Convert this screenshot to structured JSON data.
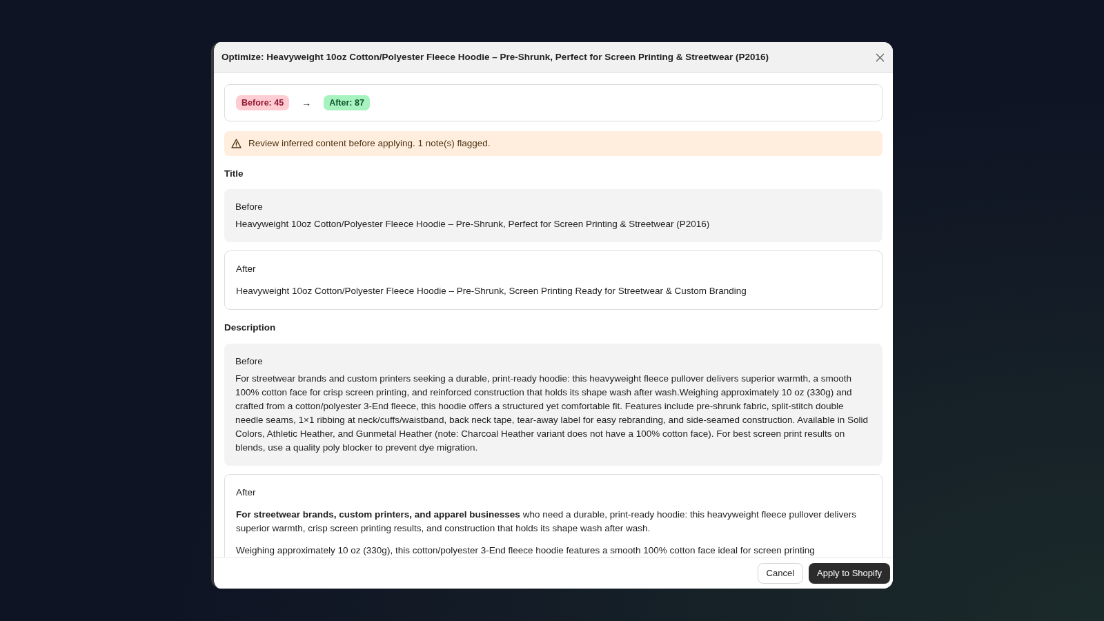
{
  "dialog": {
    "title": "Optimize: Heavyweight 10oz Cotton/Polyester Fleece Hoodie – Pre-Shrunk, Perfect for Screen Printing & Streetwear (P2016)"
  },
  "scores": {
    "before": "Before: 45",
    "arrow": "→",
    "after": "After: 87"
  },
  "warning": "Review inferred content before applying. 1 note(s) flagged.",
  "sections": [
    {
      "heading": "Title",
      "before_label": "Before",
      "before": [
        "Heavyweight 10oz Cotton/Polyester Fleece Hoodie – Pre-Shrunk, Perfect for Screen Printing & Streetwear (P2016)"
      ],
      "after_label": "After",
      "after": [
        "Heavyweight 10oz Cotton/Polyester Fleece Hoodie – Pre-Shrunk, Screen Printing Ready for Streetwear & Custom Branding"
      ]
    },
    {
      "heading": "Description",
      "before_label": "Before",
      "before": [
        "For streetwear brands and custom printers seeking a durable, print-ready hoodie: this heavyweight fleece pullover delivers superior warmth, a smooth 100% cotton face for crisp screen printing, and reinforced construction that holds its shape wash after wash.Weighing approximately 10 oz (330g) and crafted from a cotton/polyester 3-End fleece, this hoodie offers a structured yet comfortable fit. Features include pre-shrunk fabric, split-stitch double needle seams, 1×1 ribbing at neck/cuffs/waistband, back neck tape, tear-away label for easy rebranding, and side-seamed construction. Available in Solid Colors, Athletic Heather, and Gunmetal Heather (note: Charcoal Heather variant does not have a 100% cotton face). For best screen print results on blends, use a quality poly blocker to prevent dye migration."
      ],
      "after_label": "After",
      "after": [
        "**For streetwear brands, custom printers, and apparel businesses** who need a durable, print-ready hoodie: this heavyweight fleece pullover delivers superior warmth, crisp screen printing results, and construction that holds its shape wash after wash.",
        "Weighing approximately 10 oz (330g), this cotton/polyester 3-End fleece hoodie features a smooth 100% cotton face ideal for screen printing"
      ]
    }
  ],
  "buttons": {
    "cancel": "Cancel",
    "apply": "Apply to Shopify"
  }
}
